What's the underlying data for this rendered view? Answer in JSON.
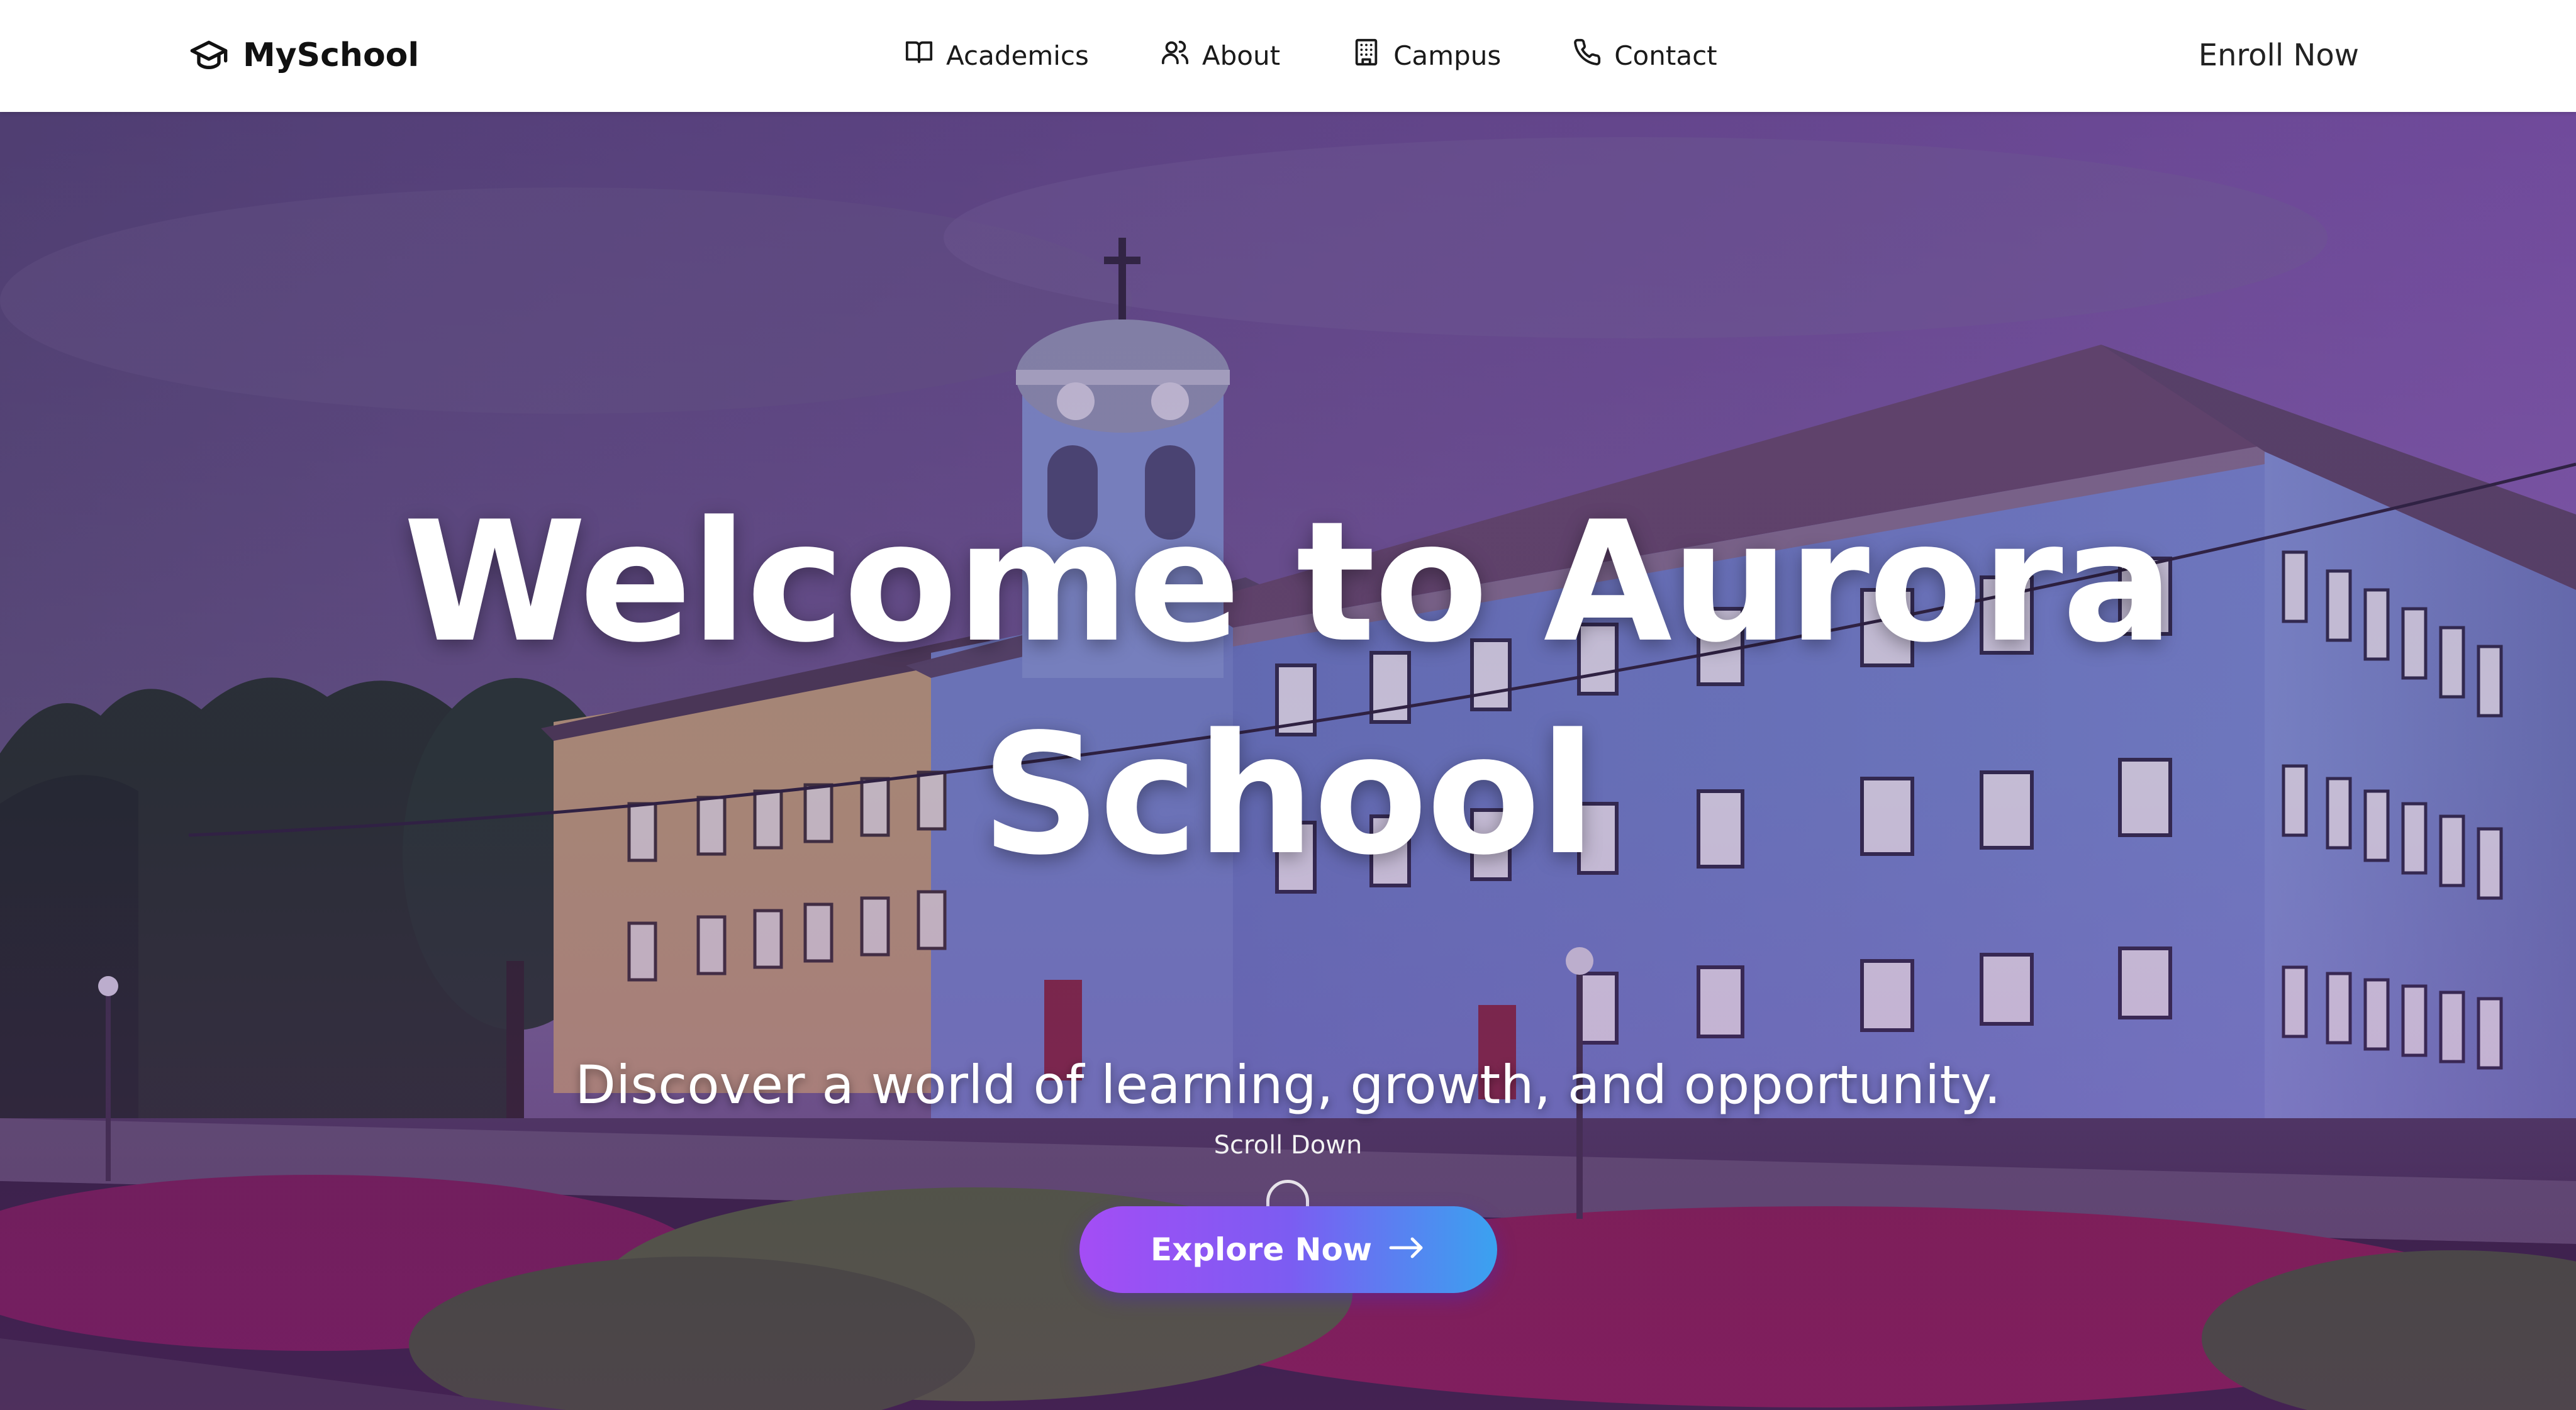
{
  "brand": {
    "name": "MySchool",
    "icon": "graduation-cap-icon"
  },
  "nav": {
    "items": [
      {
        "label": "Academics",
        "icon": "book-icon"
      },
      {
        "label": "About",
        "icon": "users-icon"
      },
      {
        "label": "Campus",
        "icon": "building-icon"
      },
      {
        "label": "Contact",
        "icon": "phone-icon"
      }
    ],
    "enroll_label": "Enroll Now"
  },
  "hero": {
    "title_line1": "Welcome to Aurora",
    "title_line2": "School",
    "subtitle": "Discover a world of learning, growth, and opportunity.",
    "scroll_label": "Scroll Down",
    "cta_label": "Explore Now",
    "cta_icon": "arrow-right-icon"
  },
  "colors": {
    "cta_gradient_start": "#a44df5",
    "cta_gradient_end": "#3aa2f0",
    "overlay_tint": "#6a3aa0"
  }
}
